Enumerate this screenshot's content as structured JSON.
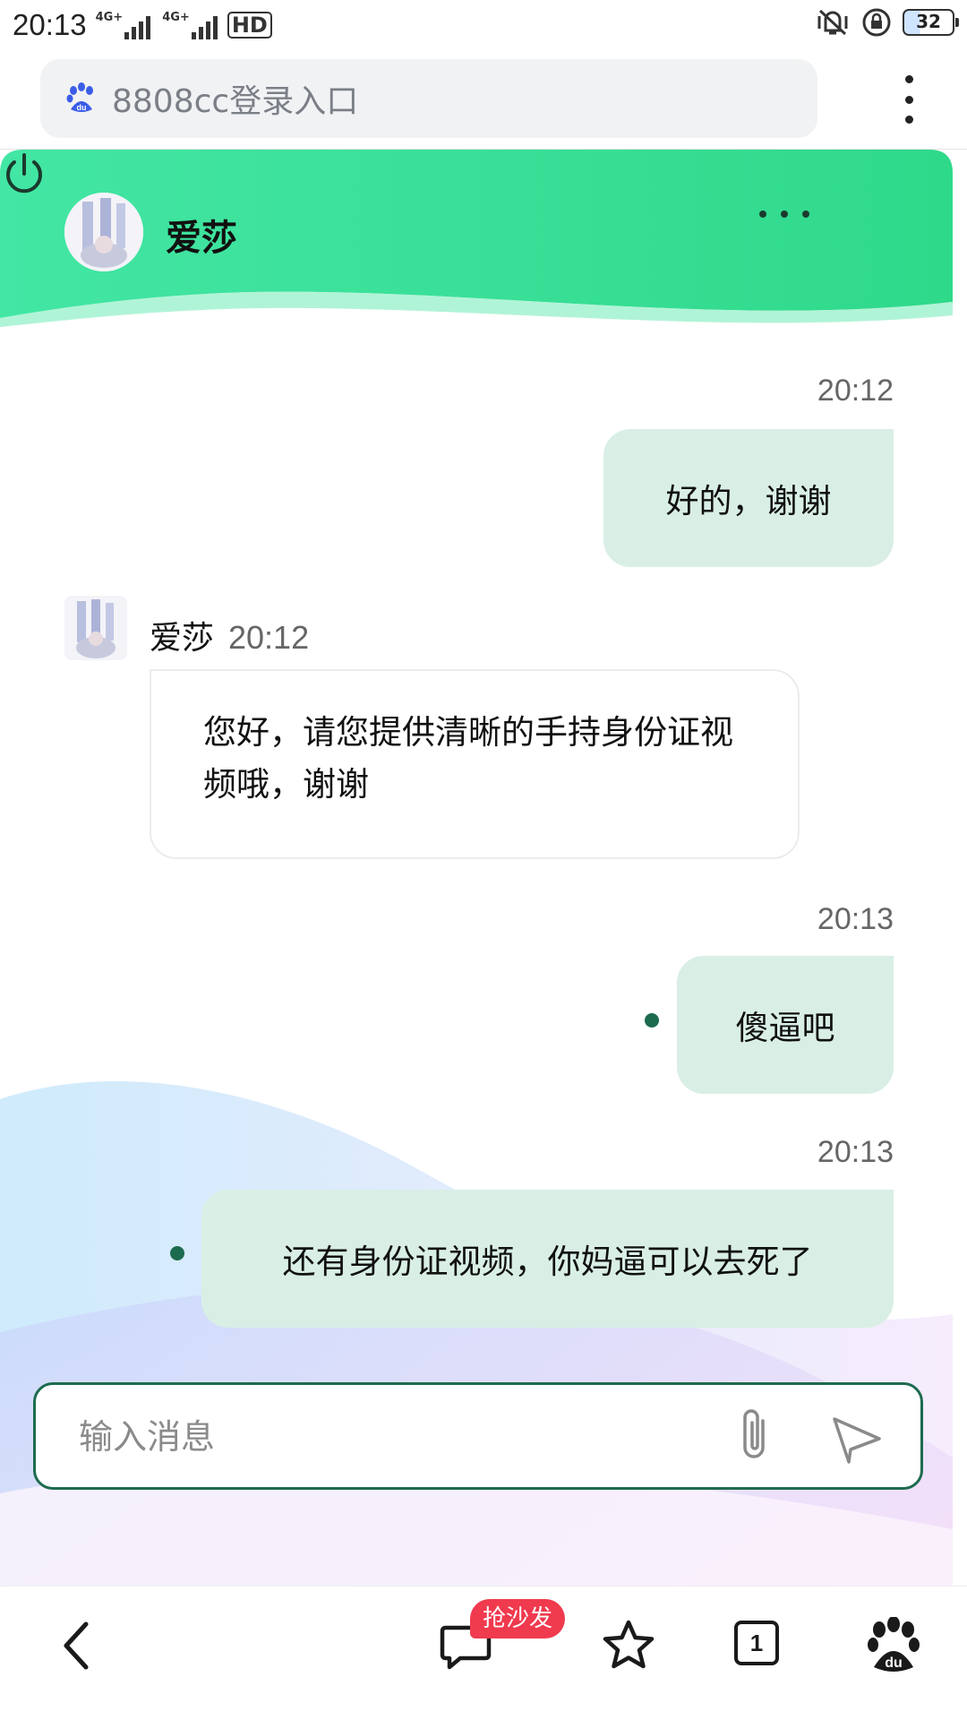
{
  "status_bar": {
    "time": "20:13",
    "signal1_label": "4G+",
    "signal2_label": "4G+",
    "hd_label": "HD",
    "battery_level": "32",
    "icons": [
      "vibrate-icon",
      "rotation-lock-icon"
    ]
  },
  "browser": {
    "address_text": "8808cc登录入口",
    "address_icon": "baidu-paw-icon",
    "menu_icon": "more-vertical-icon"
  },
  "chat": {
    "header": {
      "agent_name": "爱莎",
      "more_icon": "more-horizontal-icon",
      "power_icon": "power-icon",
      "gradient_from": "#43e6a4",
      "gradient_to": "#2fd98a"
    },
    "messages": [
      {
        "sender": "user",
        "time": "20:12",
        "text": "好的，谢谢"
      },
      {
        "sender": "agent",
        "name": "爱莎",
        "time": "20:12",
        "text": "您好，请您提供清晰的手持身份证视频哦，谢谢"
      },
      {
        "sender": "user",
        "time": "20:13",
        "text": "傻逼吧"
      },
      {
        "sender": "user",
        "time": "20:13",
        "text": "还有身份证视频，你妈逼可以去死了"
      }
    ],
    "input": {
      "placeholder": "输入消息",
      "value": "",
      "attach_icon": "paperclip-icon",
      "send_icon": "send-icon"
    },
    "colors": {
      "user_bubble": "#d9efe5",
      "accent": "#1d6b4f"
    }
  },
  "bottom_nav": {
    "back_icon": "back-icon",
    "comment_icon": "comment-icon",
    "comment_badge": "抢沙发",
    "star_icon": "star-icon",
    "tab_count": "1",
    "home_icon": "baidu-paw-icon"
  }
}
